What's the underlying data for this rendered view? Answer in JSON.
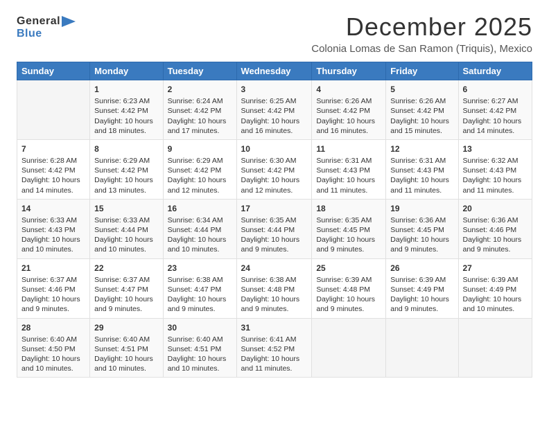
{
  "logo": {
    "general": "General",
    "blue": "Blue",
    "icon": "▶"
  },
  "title": "December 2025",
  "subtitle": "Colonia Lomas de San Ramon (Triquis), Mexico",
  "days_header": [
    "Sunday",
    "Monday",
    "Tuesday",
    "Wednesday",
    "Thursday",
    "Friday",
    "Saturday"
  ],
  "weeks": [
    [
      {
        "day": "",
        "content": ""
      },
      {
        "day": "1",
        "content": "Sunrise: 6:23 AM\nSunset: 4:42 PM\nDaylight: 10 hours\nand 18 minutes."
      },
      {
        "day": "2",
        "content": "Sunrise: 6:24 AM\nSunset: 4:42 PM\nDaylight: 10 hours\nand 17 minutes."
      },
      {
        "day": "3",
        "content": "Sunrise: 6:25 AM\nSunset: 4:42 PM\nDaylight: 10 hours\nand 16 minutes."
      },
      {
        "day": "4",
        "content": "Sunrise: 6:26 AM\nSunset: 4:42 PM\nDaylight: 10 hours\nand 16 minutes."
      },
      {
        "day": "5",
        "content": "Sunrise: 6:26 AM\nSunset: 4:42 PM\nDaylight: 10 hours\nand 15 minutes."
      },
      {
        "day": "6",
        "content": "Sunrise: 6:27 AM\nSunset: 4:42 PM\nDaylight: 10 hours\nand 14 minutes."
      }
    ],
    [
      {
        "day": "7",
        "content": "Sunrise: 6:28 AM\nSunset: 4:42 PM\nDaylight: 10 hours\nand 14 minutes."
      },
      {
        "day": "8",
        "content": "Sunrise: 6:29 AM\nSunset: 4:42 PM\nDaylight: 10 hours\nand 13 minutes."
      },
      {
        "day": "9",
        "content": "Sunrise: 6:29 AM\nSunset: 4:42 PM\nDaylight: 10 hours\nand 12 minutes."
      },
      {
        "day": "10",
        "content": "Sunrise: 6:30 AM\nSunset: 4:42 PM\nDaylight: 10 hours\nand 12 minutes."
      },
      {
        "day": "11",
        "content": "Sunrise: 6:31 AM\nSunset: 4:43 PM\nDaylight: 10 hours\nand 11 minutes."
      },
      {
        "day": "12",
        "content": "Sunrise: 6:31 AM\nSunset: 4:43 PM\nDaylight: 10 hours\nand 11 minutes."
      },
      {
        "day": "13",
        "content": "Sunrise: 6:32 AM\nSunset: 4:43 PM\nDaylight: 10 hours\nand 11 minutes."
      }
    ],
    [
      {
        "day": "14",
        "content": "Sunrise: 6:33 AM\nSunset: 4:43 PM\nDaylight: 10 hours\nand 10 minutes."
      },
      {
        "day": "15",
        "content": "Sunrise: 6:33 AM\nSunset: 4:44 PM\nDaylight: 10 hours\nand 10 minutes."
      },
      {
        "day": "16",
        "content": "Sunrise: 6:34 AM\nSunset: 4:44 PM\nDaylight: 10 hours\nand 10 minutes."
      },
      {
        "day": "17",
        "content": "Sunrise: 6:35 AM\nSunset: 4:44 PM\nDaylight: 10 hours\nand 9 minutes."
      },
      {
        "day": "18",
        "content": "Sunrise: 6:35 AM\nSunset: 4:45 PM\nDaylight: 10 hours\nand 9 minutes."
      },
      {
        "day": "19",
        "content": "Sunrise: 6:36 AM\nSunset: 4:45 PM\nDaylight: 10 hours\nand 9 minutes."
      },
      {
        "day": "20",
        "content": "Sunrise: 6:36 AM\nSunset: 4:46 PM\nDaylight: 10 hours\nand 9 minutes."
      }
    ],
    [
      {
        "day": "21",
        "content": "Sunrise: 6:37 AM\nSunset: 4:46 PM\nDaylight: 10 hours\nand 9 minutes."
      },
      {
        "day": "22",
        "content": "Sunrise: 6:37 AM\nSunset: 4:47 PM\nDaylight: 10 hours\nand 9 minutes."
      },
      {
        "day": "23",
        "content": "Sunrise: 6:38 AM\nSunset: 4:47 PM\nDaylight: 10 hours\nand 9 minutes."
      },
      {
        "day": "24",
        "content": "Sunrise: 6:38 AM\nSunset: 4:48 PM\nDaylight: 10 hours\nand 9 minutes."
      },
      {
        "day": "25",
        "content": "Sunrise: 6:39 AM\nSunset: 4:48 PM\nDaylight: 10 hours\nand 9 minutes."
      },
      {
        "day": "26",
        "content": "Sunrise: 6:39 AM\nSunset: 4:49 PM\nDaylight: 10 hours\nand 9 minutes."
      },
      {
        "day": "27",
        "content": "Sunrise: 6:39 AM\nSunset: 4:49 PM\nDaylight: 10 hours\nand 10 minutes."
      }
    ],
    [
      {
        "day": "28",
        "content": "Sunrise: 6:40 AM\nSunset: 4:50 PM\nDaylight: 10 hours\nand 10 minutes."
      },
      {
        "day": "29",
        "content": "Sunrise: 6:40 AM\nSunset: 4:51 PM\nDaylight: 10 hours\nand 10 minutes."
      },
      {
        "day": "30",
        "content": "Sunrise: 6:40 AM\nSunset: 4:51 PM\nDaylight: 10 hours\nand 10 minutes."
      },
      {
        "day": "31",
        "content": "Sunrise: 6:41 AM\nSunset: 4:52 PM\nDaylight: 10 hours\nand 11 minutes."
      },
      {
        "day": "",
        "content": ""
      },
      {
        "day": "",
        "content": ""
      },
      {
        "day": "",
        "content": ""
      }
    ]
  ]
}
